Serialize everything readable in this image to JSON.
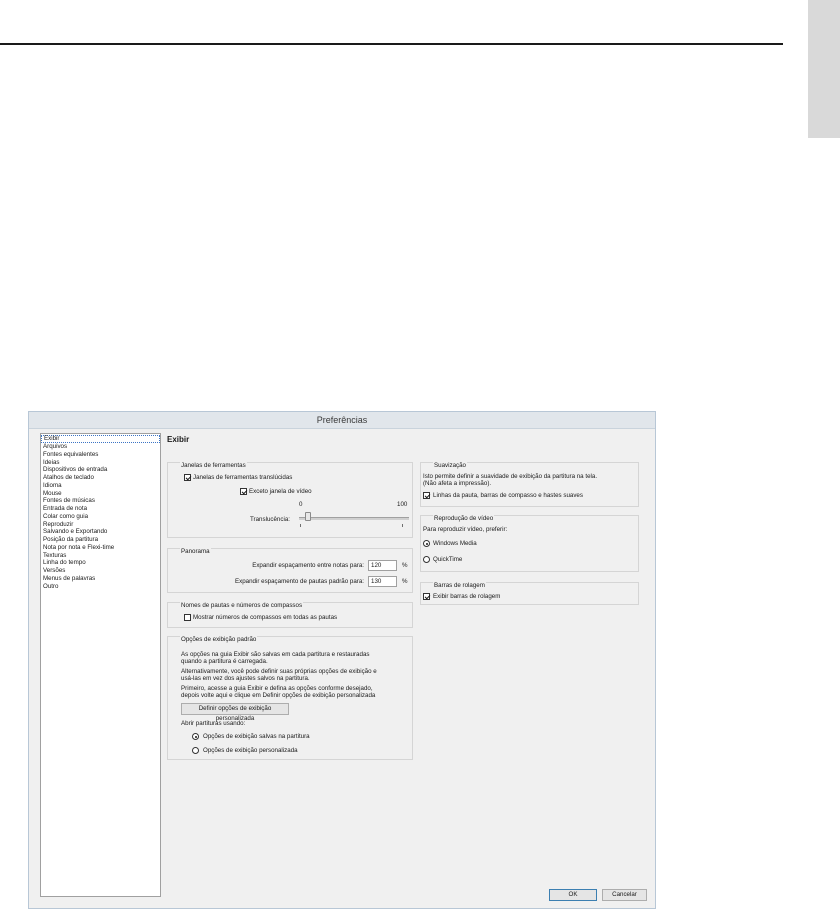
{
  "dialog": {
    "title": "Preferências",
    "page_title": "Exibir",
    "nav_items": [
      {
        "label": "Exibir",
        "selected": true
      },
      {
        "label": "Arquivos"
      },
      {
        "label": "Fontes equivalentes"
      },
      {
        "label": "Ideias"
      },
      {
        "label": "Dispositivos de entrada"
      },
      {
        "label": "Atalhos de teclado"
      },
      {
        "label": "Idioma"
      },
      {
        "label": "Mouse"
      },
      {
        "label": "Fontes de músicas"
      },
      {
        "label": "Entrada de nota"
      },
      {
        "label": "Colar como guia"
      },
      {
        "label": "Reproduzir"
      },
      {
        "label": "Salvando e Exportando"
      },
      {
        "label": "Posição da partitura"
      },
      {
        "label": "Nota por nota e Flexi-time"
      },
      {
        "label": "Texturas"
      },
      {
        "label": "Linha do tempo"
      },
      {
        "label": "Versões"
      },
      {
        "label": "Menus de palavras"
      },
      {
        "label": "Outro"
      }
    ],
    "toolwindows": {
      "label": "Janelas de ferramentas",
      "translucent_label": "Janelas de ferramentas translúcidas",
      "translucent_checked": true,
      "except_video_label": "Exceto janela de vídeo",
      "except_video_checked": true,
      "slider_min": "0",
      "slider_max": "100",
      "slider_label": "Translucência:",
      "slider_value": 0.08
    },
    "panorama": {
      "label": "Panorama",
      "notes_label": "Expandir espaçamento entre notas para:",
      "notes_value": "120",
      "notes_unit": "%",
      "staves_label": "Expandir espaçamento de pautas padrão para:",
      "staves_value": "130",
      "staves_unit": "%"
    },
    "names": {
      "label": "Nomes de pautas e números de compassos",
      "show_numbers_label": "Mostrar números de compassos em todas as pautas",
      "show_numbers_checked": false
    },
    "default_view": {
      "label": "Opções de exibição padrão",
      "p1_line1": "As opções na guia Exibir são salvas em cada partitura e restauradas",
      "p1_line2": "quando a partitura é carregada.",
      "p2_line1": "Alternativamente, você pode definir suas próprias opções de exibição e",
      "p2_line2": "usá-las em vez dos ajustes salvos na partitura.",
      "p3_line1": "Primeiro, acesse a guia Exibir e defina as opções conforme desejado,",
      "p3_line2": "depois volte aqui e clique em Definir opções de exibição personalizada",
      "define_button": "Definir opções de exibição personalizada",
      "open_label": "Abrir partituras usando:",
      "radio_saved": "Opções de exibição salvas na partitura",
      "radio_custom": "Opções de exibição personalizada",
      "selected": "saved"
    },
    "smoothing": {
      "label": "Suavização",
      "desc_line1": "Isto permite definir a suavidade de exibição da partitura na tela.",
      "desc_line2": "(Não afeta a impressão).",
      "lines_label": "Linhas da pauta, barras de compasso e hastes suaves",
      "lines_checked": true
    },
    "video": {
      "label": "Reprodução de vídeo",
      "prefer_label": "Para reproduzir vídeo, preferir:",
      "windows_media": "Windows Media",
      "quicktime": "QuickTime",
      "selected": "windows_media"
    },
    "scrollbars": {
      "label": "Barras de rolagem",
      "show_label": "Exibir barras de rolagem",
      "show_checked": true
    },
    "ok_button": "OK",
    "cancel_button": "Cancelar"
  }
}
